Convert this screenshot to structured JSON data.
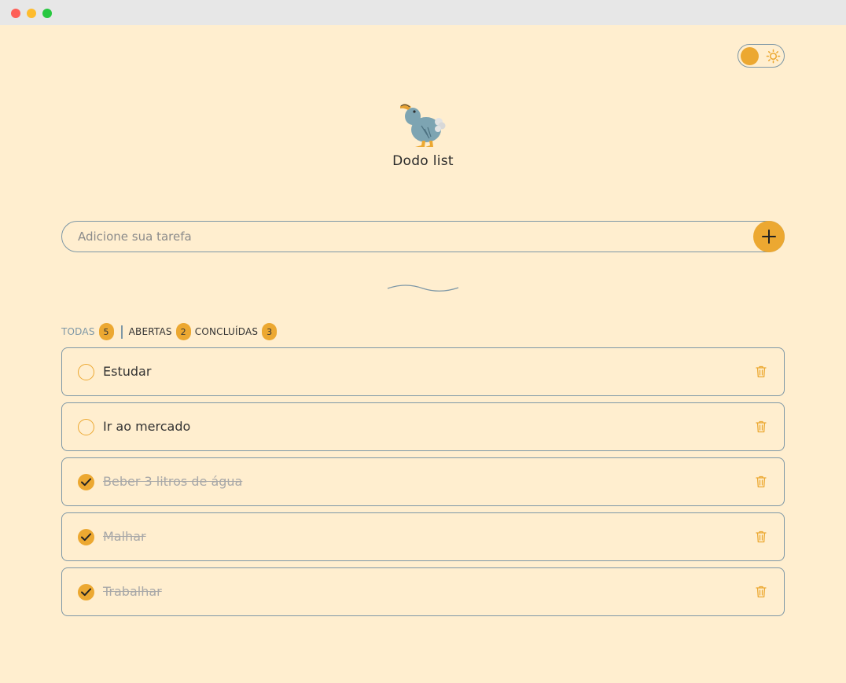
{
  "app": {
    "title": "Dodo list",
    "logo_icon": "dodo-bird-icon"
  },
  "theme_toggle": {
    "mode": "light",
    "icon": "sun-icon"
  },
  "task_input": {
    "value": "",
    "placeholder": "Adicione sua tarefa",
    "add_icon": "plus-icon"
  },
  "filters": [
    {
      "label": "TODAS",
      "count": "5",
      "active": true
    },
    {
      "label": "ABERTAS",
      "count": "2",
      "active": false
    },
    {
      "label": "CONCLUÍDAS",
      "count": "3",
      "active": false
    }
  ],
  "tasks": [
    {
      "text": "Estudar",
      "done": false
    },
    {
      "text": "Ir ao mercado",
      "done": false
    },
    {
      "text": "Beber 3 litros de água",
      "done": true
    },
    {
      "text": "Malhar",
      "done": true
    },
    {
      "text": "Trabalhar",
      "done": true
    }
  ],
  "colors": {
    "background": "#ffeecf",
    "accent": "#eca831",
    "border": "#7d97a6",
    "text": "#333333",
    "done_text": "#a8a8a8"
  }
}
